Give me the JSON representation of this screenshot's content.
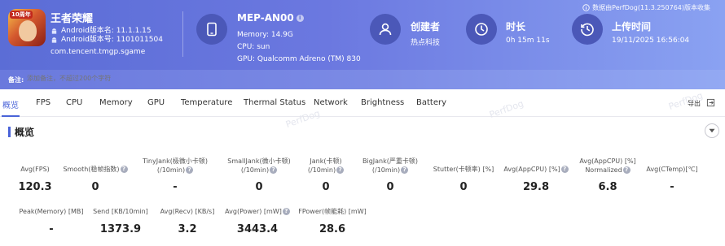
{
  "app": {
    "name": "王者荣耀",
    "android_version_label": "Android版本名: 11.1.1.15",
    "android_code_label": "Android版本号: 1101011504",
    "package": "com.tencent.tmgp.sgame",
    "icon_badge": "10周年"
  },
  "device": {
    "name": "MEP-AN00",
    "info_icon": "i",
    "memory": "Memory: 14.9G",
    "cpu": "CPU: sun",
    "gpu": "GPU: Qualcomm Adreno (TM) 830"
  },
  "creator": {
    "title": "创建者",
    "value": "热点科技"
  },
  "duration": {
    "title": "时长",
    "value": "0h 15m 11s"
  },
  "upload": {
    "title": "上传时间",
    "value": "19/11/2025 16:56:04"
  },
  "source_text": "数据由PerfDog(11.3.250764)版本收集",
  "note": {
    "label": "备注:",
    "placeholder": "添加备注，不超过200个字符"
  },
  "tabs": [
    "概览",
    "FPS",
    "CPU",
    "Memory",
    "GPU",
    "Temperature",
    "Thermal Status",
    "Network",
    "Brightness",
    "Battery"
  ],
  "active_tab": "概览",
  "export_label": "导出",
  "watermark": "PerfDog",
  "section_title": "概览",
  "metrics_row1": [
    {
      "label1": "Avg(FPS)",
      "label2": "",
      "help": false,
      "value": "120.3"
    },
    {
      "label1": "Smooth(稳帧指数)",
      "label2": "",
      "help": true,
      "value": "0"
    },
    {
      "label1": "TinyJank(极微小卡顿)",
      "label2": "(/10min)",
      "help": true,
      "value": "-"
    },
    {
      "label1": "SmallJank(微小卡顿)",
      "label2": "(/10min)",
      "help": true,
      "value": "0"
    },
    {
      "label1": "Jank(卡顿)",
      "label2": "(/10min)",
      "help": true,
      "value": "0"
    },
    {
      "label1": "BigJank(严重卡顿)",
      "label2": "(/10min)",
      "help": true,
      "value": "0"
    },
    {
      "label1": "Stutter(卡顿率) [%]",
      "label2": "",
      "help": false,
      "value": "0"
    },
    {
      "label1": "Avg(AppCPU) [%]",
      "label2": "",
      "help": true,
      "value": "29.8"
    },
    {
      "label1": "Avg(AppCPU) [%]",
      "label2": "Normalized",
      "help": true,
      "value": "6.8"
    },
    {
      "label1": "Avg(CTemp)[℃]",
      "label2": "",
      "help": false,
      "value": "-"
    }
  ],
  "metrics_row2": [
    {
      "label1": "Peak(Memory) [MB]",
      "help": false,
      "value": "-"
    },
    {
      "label1": "Send [KB/10min]",
      "help": false,
      "value": "1373.9"
    },
    {
      "label1": "Avg(Recv) [KB/s]",
      "help": false,
      "value": "3.2"
    },
    {
      "label1": "Avg(Power) [mW]",
      "help": true,
      "value": "3443.4"
    },
    {
      "label1": "FPower(帧能耗) [mW]",
      "help": false,
      "value": "28.6"
    }
  ],
  "help_glyph": "?"
}
